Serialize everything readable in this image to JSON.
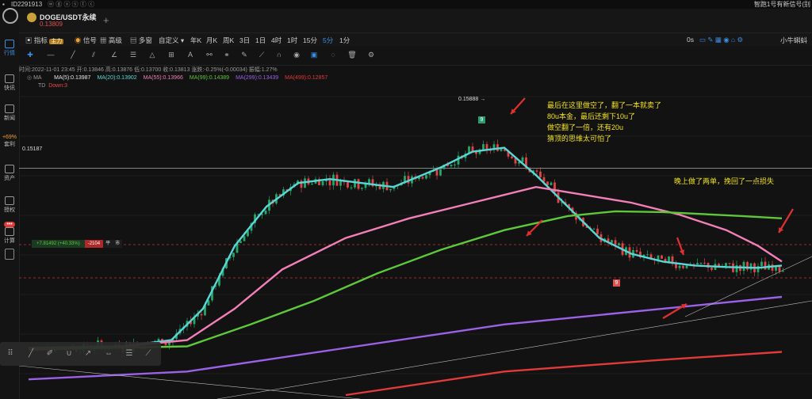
{
  "topbar": {
    "user_id": "ID2291913",
    "right_text": "智跑1号有新信号(别"
  },
  "sidebar": [
    {
      "label": "行情",
      "icon": "candles-icon"
    },
    {
      "label": "快讯",
      "icon": "news-icon"
    },
    {
      "label": "新闻",
      "icon": "document-icon"
    },
    {
      "label": "套利",
      "icon": "arbitrage-icon",
      "extra": "+69%"
    },
    {
      "label": "资产",
      "icon": "wallet-icon"
    },
    {
      "label": "授权",
      "icon": "key-icon"
    },
    {
      "label": "计算",
      "icon": "calculator-icon",
      "extra": "•••"
    }
  ],
  "header": {
    "symbol": "DOGE/USDT永续",
    "price": "0.13809",
    "add_symbol": "+"
  },
  "toolbar": {
    "indicator": "指标",
    "main": "主力",
    "signal": "信号",
    "advanced": "高级",
    "multi_window": "多窗",
    "custom": "自定义",
    "intervals": [
      "年K",
      "月K",
      "周K",
      "3日",
      "1日",
      "4时",
      "1时",
      "15分",
      "5分",
      "1分"
    ],
    "active_interval": "5分",
    "right_label": "0s",
    "right_name": "小牛蝌蚪"
  },
  "info": {
    "line": "时间:2022-11-01 23:45  开:0.13846  高:0.13876  低:0.13700  收:0.13813  涨跌:-0.25%(-0.00034)  振幅:1.27%"
  },
  "ma": [
    {
      "label": "MA(5):0.13987",
      "color": "#e8e8e8"
    },
    {
      "label": "MA(20):0.13902",
      "color": "#59d7d7"
    },
    {
      "label": "MA(55):0.13966",
      "color": "#f27fb8"
    },
    {
      "label": "MA(99):0.14389",
      "color": "#5ec83a"
    },
    {
      "label": "MA(299):0.13439",
      "color": "#9b61e6"
    },
    {
      "label": "MA(499):0.12857",
      "color": "#e03a3a"
    }
  ],
  "ma_prefix": "MA",
  "td": {
    "name": "TD",
    "value": "Down:3"
  },
  "chart_labels": {
    "high_price": "0.15888",
    "line_price": "0.15187",
    "td_count_top": "9",
    "td_count_low": "9",
    "position": {
      "pnl": "+7.81492 (+40.33%)",
      "qty": "-2104",
      "close": "平",
      "market": "市"
    }
  },
  "annotations": {
    "note1": [
      "最后在这里做空了，翻了一本就卖了",
      "80u本金，最后还剩下10u了",
      "做空翻了一倍，还有20u",
      "猜顶的思维太可怕了"
    ],
    "note2": "晚上做了两单，挽回了一点损失"
  },
  "chart_data": {
    "type": "line",
    "title": "DOGE/USDT永续 5分",
    "ylabel": "",
    "series": [
      {
        "name": "MA(20)",
        "color": "#59d7d7",
        "points": [
          [
            0,
            0.129
          ],
          [
            60,
            0.1291
          ],
          [
            120,
            0.1292
          ],
          [
            180,
            0.13
          ],
          [
            220,
            0.134
          ],
          [
            260,
            0.142
          ],
          [
            300,
            0.147
          ],
          [
            340,
            0.15
          ],
          [
            380,
            0.1505
          ],
          [
            420,
            0.15
          ],
          [
            460,
            0.1495
          ],
          [
            520,
            0.152
          ],
          [
            560,
            0.154
          ],
          [
            600,
            0.1545
          ],
          [
            640,
            0.151
          ],
          [
            680,
            0.147
          ],
          [
            720,
            0.143
          ],
          [
            760,
            0.141
          ],
          [
            800,
            0.14
          ],
          [
            840,
            0.1395
          ],
          [
            880,
            0.1393
          ],
          [
            920,
            0.1392
          ],
          [
            950,
            0.1395
          ]
        ]
      },
      {
        "name": "MA(55)",
        "color": "#f27fb8",
        "points": [
          [
            0,
            0.1288
          ],
          [
            100,
            0.129
          ],
          [
            200,
            0.13
          ],
          [
            260,
            0.134
          ],
          [
            320,
            0.139
          ],
          [
            400,
            0.143
          ],
          [
            480,
            0.1455
          ],
          [
            560,
            0.1475
          ],
          [
            640,
            0.1495
          ],
          [
            700,
            0.1485
          ],
          [
            760,
            0.1475
          ],
          [
            820,
            0.146
          ],
          [
            880,
            0.144
          ],
          [
            920,
            0.142
          ],
          [
            950,
            0.14
          ]
        ]
      },
      {
        "name": "MA(99)",
        "color": "#5ec83a",
        "points": [
          [
            0,
            0.129
          ],
          [
            100,
            0.129
          ],
          [
            200,
            0.1292
          ],
          [
            280,
            0.132
          ],
          [
            360,
            0.135
          ],
          [
            440,
            0.1385
          ],
          [
            520,
            0.1415
          ],
          [
            600,
            0.144
          ],
          [
            680,
            0.1458
          ],
          [
            740,
            0.1464
          ],
          [
            800,
            0.1463
          ],
          [
            860,
            0.146
          ],
          [
            900,
            0.1458
          ],
          [
            950,
            0.1455
          ]
        ]
      },
      {
        "name": "MA(299)",
        "color": "#9b61e6",
        "points": [
          [
            0,
            0.125
          ],
          [
            200,
            0.126
          ],
          [
            400,
            0.129
          ],
          [
            600,
            0.132
          ],
          [
            800,
            0.134
          ],
          [
            950,
            0.1355
          ]
        ]
      },
      {
        "name": "MA(499)",
        "color": "#e03a3a",
        "points": [
          [
            400,
            0.123
          ],
          [
            600,
            0.126
          ],
          [
            800,
            0.1275
          ],
          [
            950,
            0.1285
          ]
        ]
      }
    ]
  }
}
